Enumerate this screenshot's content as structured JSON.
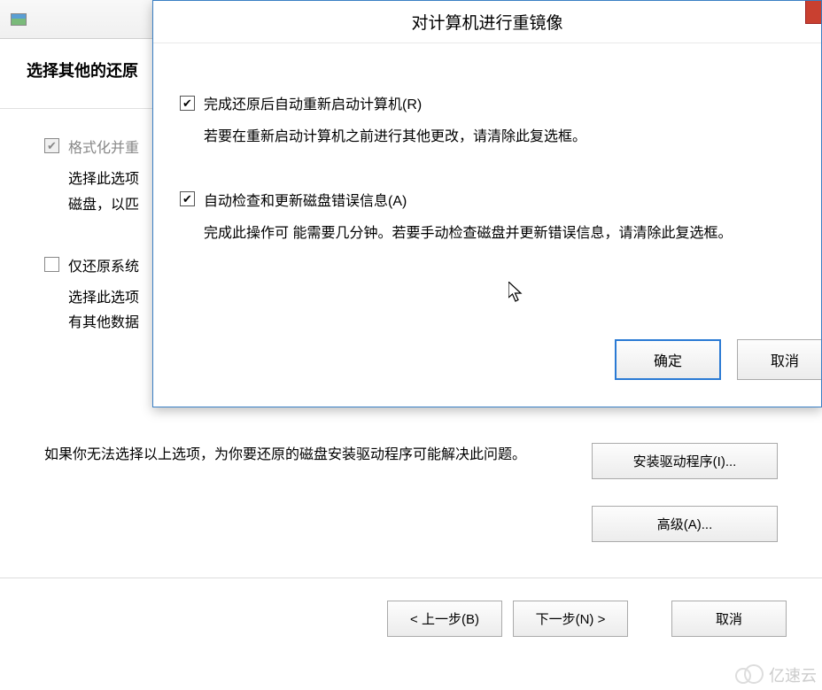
{
  "bg": {
    "headerTitle": "选择其他的还原",
    "option1": {
      "label": "格式化并重",
      "checked": true,
      "desc1": "选择此选项",
      "desc2": "磁盘，以匹"
    },
    "option2": {
      "label": "仅还原系统",
      "checked": false,
      "desc1": "选择此选项",
      "desc2": "有其他数据"
    },
    "driverText": "如果你无法选择以上选项，为你要还原的磁盘安装驱动程序可能解决此问题。",
    "driverButton": "安装驱动程序(I)...",
    "advancedButton": "高级(A)...",
    "backButton": "< 上一步(B)",
    "nextButton": "下一步(N) >",
    "cancelButton": "取消"
  },
  "dialog": {
    "title": "对计算机进行重镜像",
    "option1": {
      "label": "完成还原后自动重新启动计算机(R)",
      "checked": true,
      "desc": "若要在重新启动计算机之前进行其他更改，请清除此复选框。"
    },
    "option2": {
      "label": "自动检查和更新磁盘错误信息(A)",
      "checked": true,
      "desc": "完成此操作可 能需要几分钟。若要手动检查磁盘并更新错误信息，请清除此复选框。"
    },
    "okButton": "确定",
    "cancelButton": "取消"
  },
  "watermark": "亿速云"
}
